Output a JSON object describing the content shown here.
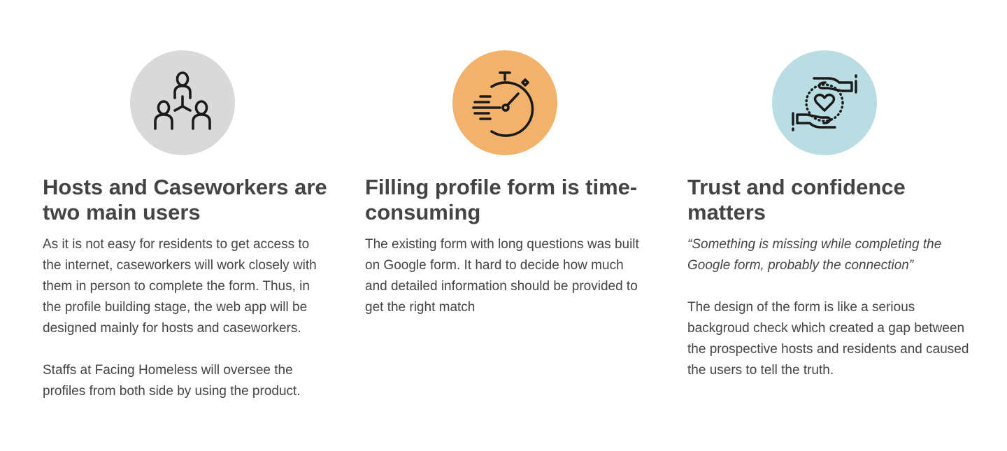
{
  "colors": {
    "text": "#444444",
    "circle_users": "#d9d9d9",
    "circle_time": "#f3b26b",
    "circle_trust": "#b9dde2",
    "icon_stroke": "#1a1a1a"
  },
  "cards": [
    {
      "icon": "users-network-icon",
      "heading": "Hosts and Caseworkers are two main users",
      "paragraphs": [
        "As it is not easy for residents to get access to the internet, caseworkers will work closely with them in person to complete the form. Thus, in the profile building stage, the web app will be designed mainly for hosts and caseworkers.",
        "Staffs at Facing Homeless will oversee the profiles from both side by using the product."
      ]
    },
    {
      "icon": "stopwatch-icon",
      "heading": "Filling profile form is time-consuming",
      "paragraphs": [
        "The existing form with long questions was built on Google form. It hard to decide how much and detailed information should be provided to get the right match"
      ]
    },
    {
      "icon": "hands-heart-icon",
      "heading": "Trust and confidence matters",
      "quote": "“Something is missing while completing the Google form, probably the connection”",
      "paragraphs": [
        "The design of the form is like a serious backgroud check which created a gap between the prospective hosts and residents and caused the users to tell the truth."
      ]
    }
  ]
}
